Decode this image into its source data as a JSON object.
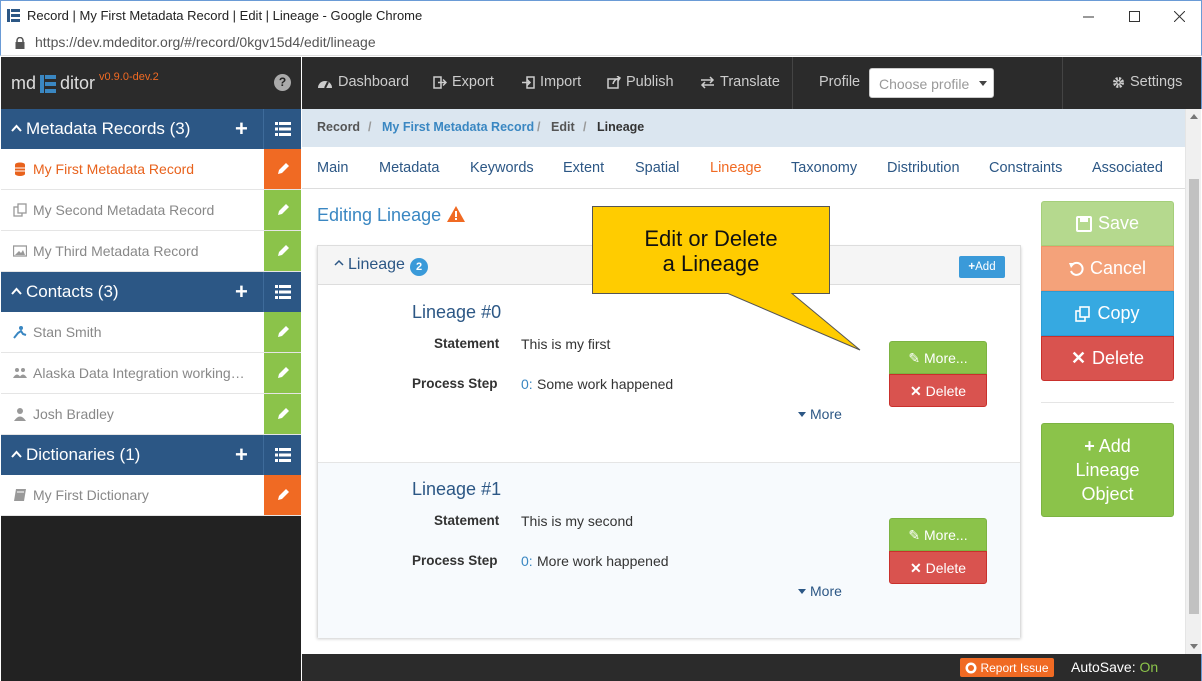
{
  "window": {
    "title": "Record | My First Metadata Record | Edit | Lineage - Google Chrome",
    "url": "https://dev.mdeditor.org/#/record/0kgv15d4/edit/lineage"
  },
  "brand": {
    "name_left": "md",
    "name_right": "ditor",
    "version": "v0.9.0-dev.2"
  },
  "sidebar": {
    "records": {
      "title": "Metadata Records (3)",
      "items": [
        {
          "label": "My First Metadata Record",
          "icon": "database-icon"
        },
        {
          "label": "My Second Metadata Record",
          "icon": "copy-icon"
        },
        {
          "label": "My Third Metadata Record",
          "icon": "image-icon"
        }
      ]
    },
    "contacts": {
      "title": "Contacts (3)",
      "items": [
        {
          "label": "Stan Smith",
          "icon": "person-icon"
        },
        {
          "label": "Alaska Data Integration working…",
          "icon": "group-icon"
        },
        {
          "label": "Josh Bradley",
          "icon": "user-icon"
        }
      ]
    },
    "dictionaries": {
      "title": "Dictionaries (1)",
      "items": [
        {
          "label": "My First Dictionary",
          "icon": "book-icon"
        }
      ]
    }
  },
  "topnav": {
    "dashboard": "Dashboard",
    "export": "Export",
    "import": "Import",
    "publish": "Publish",
    "translate": "Translate",
    "profile_label": "Profile",
    "profile_placeholder": "Choose profile",
    "settings": "Settings"
  },
  "breadcrumb": {
    "record": "Record",
    "sep": "/",
    "name": "My First Metadata Record",
    "edit": "Edit",
    "current": "Lineage"
  },
  "tabs": [
    "Main",
    "Metadata",
    "Keywords",
    "Extent",
    "Spatial",
    "Lineage",
    "Taxonomy",
    "Distribution",
    "Constraints",
    "Associated"
  ],
  "content": {
    "heading": "Editing Lineage",
    "panel_title": "Lineage",
    "count": "2",
    "add_label": "Add",
    "statement_label": "Statement",
    "process_label": "Process Step",
    "more_button": "More...",
    "delete_button": "Delete",
    "more_link": "More",
    "lineages": [
      {
        "title": "Lineage #0",
        "statement": "This is my first",
        "step_index": "0:",
        "step": "Some work happened"
      },
      {
        "title": "Lineage #1",
        "statement": "This is my second",
        "step_index": "0:",
        "step": "More work happened"
      }
    ]
  },
  "actions": {
    "save": "Save",
    "cancel": "Cancel",
    "copy": "Copy",
    "delete": "Delete",
    "add_line1": "Add",
    "add_line2": "Lineage",
    "add_line3": "Object"
  },
  "callout": {
    "line1": "Edit or Delete",
    "line2": "a Lineage"
  },
  "footer": {
    "report": "Report Issue",
    "autosave_label": "AutoSave:",
    "autosave_state": "On"
  },
  "colors": {
    "accent_orange": "#f06a23",
    "section_blue": "#2c5785",
    "green": "#8bc34a",
    "red": "#d9534f",
    "callout_yellow": "#ffcc00"
  }
}
